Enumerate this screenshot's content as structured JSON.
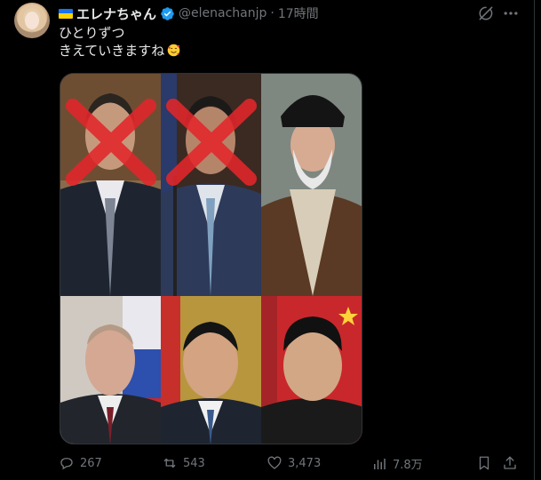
{
  "post": {
    "display_name": "エレナちゃん",
    "handle": "@elenachanjp",
    "separator": "·",
    "time": "17時間",
    "text_line1": "ひとりずつ",
    "text_line2": "きえていきますね"
  },
  "metrics": {
    "replies": "267",
    "reposts": "543",
    "likes": "3,473",
    "views": "7.8万"
  },
  "icons": {
    "verified": "verified-badge-icon",
    "grok": "grok-icon",
    "more": "more-icon",
    "emoji": "smiling-face-with-hearts-emoji",
    "reply": "reply-icon",
    "repost": "repost-icon",
    "like": "like-icon",
    "views": "views-icon",
    "bookmark": "bookmark-icon",
    "share": "share-icon"
  },
  "colors": {
    "background": "#000000",
    "text": "#e7e9ea",
    "secondary_text": "#71767b",
    "verified": "#1d9bf0",
    "cross_mark": "#e3262b"
  }
}
